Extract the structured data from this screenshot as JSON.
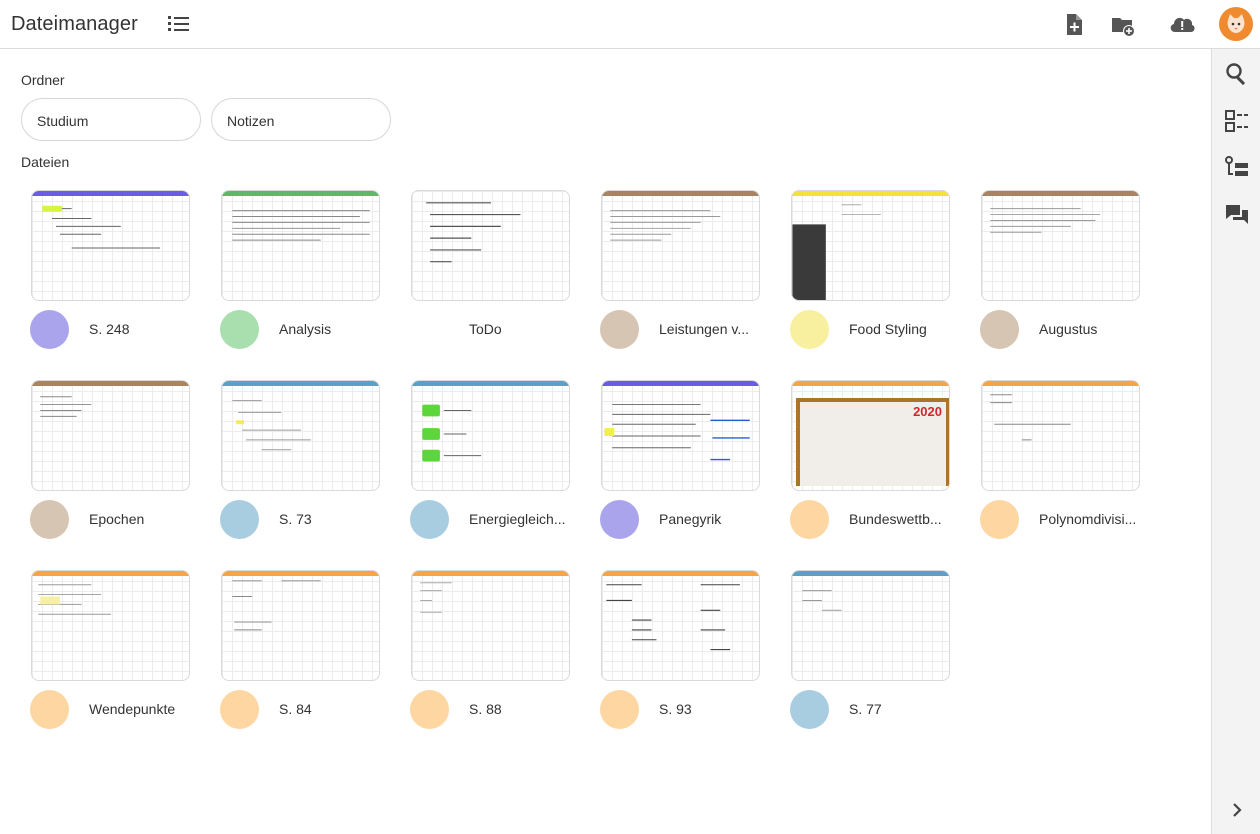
{
  "header": {
    "title": "Dateimanager"
  },
  "toolbar": {
    "list_view_icon": "list-icon",
    "new_file_icon": "file-plus-icon",
    "new_folder_icon": "folder-plus-icon",
    "sync_icon": "cloud-alert-icon",
    "avatar_icon": "cat-avatar"
  },
  "sidebar": {
    "items": [
      "search-icon",
      "list-tasks-icon",
      "tree-list-icon",
      "chat-icon",
      "chevron-right-icon"
    ]
  },
  "folders": {
    "label": "Ordner",
    "items": [
      {
        "name": "Studium"
      },
      {
        "name": "Notizen"
      }
    ]
  },
  "files": {
    "label": "Dateien",
    "items": [
      {
        "name": "S. 248",
        "color": "#aaa4ec",
        "bar": "#6a5ce6"
      },
      {
        "name": "Analysis",
        "color": "#a9dfae",
        "bar": "#5fb868"
      },
      {
        "name": "ToDo",
        "color": "",
        "bar": ""
      },
      {
        "name": "Leistungen v...",
        "color": "#d7c5b3",
        "bar": "#a88463"
      },
      {
        "name": "Food Styling",
        "color": "#f8ef9f",
        "bar": "#f3e23c"
      },
      {
        "name": "Augustus",
        "color": "#d7c5b3",
        "bar": "#a88463"
      },
      {
        "name": "Epochen",
        "color": "#d7c5b3",
        "bar": "#a88463"
      },
      {
        "name": "S. 73",
        "color": "#a9cde0",
        "bar": "#5aa1c5"
      },
      {
        "name": "Energiegleich...",
        "color": "#a9cde0",
        "bar": "#5aa1c5"
      },
      {
        "name": "Panegyrik",
        "color": "#aaa4ec",
        "bar": "#6a5ce6"
      },
      {
        "name": "Bundeswettb...",
        "color": "#fdd6a2",
        "bar": "#f6a445"
      },
      {
        "name": "Polynomdivisi...",
        "color": "#fdd6a2",
        "bar": "#f6a445"
      },
      {
        "name": "Wendepunkte",
        "color": "#fdd6a2",
        "bar": "#f6a445"
      },
      {
        "name": "S. 84",
        "color": "#fdd6a2",
        "bar": "#f6a445"
      },
      {
        "name": "S. 88",
        "color": "#fdd6a2",
        "bar": "#f6a445"
      },
      {
        "name": "S. 93",
        "color": "#fdd6a2",
        "bar": "#f6a445"
      },
      {
        "name": "S. 77",
        "color": "#a9cde0",
        "bar": "#5aa1c5"
      }
    ]
  },
  "thumbnail_extras": {
    "year_badge": "2020"
  }
}
